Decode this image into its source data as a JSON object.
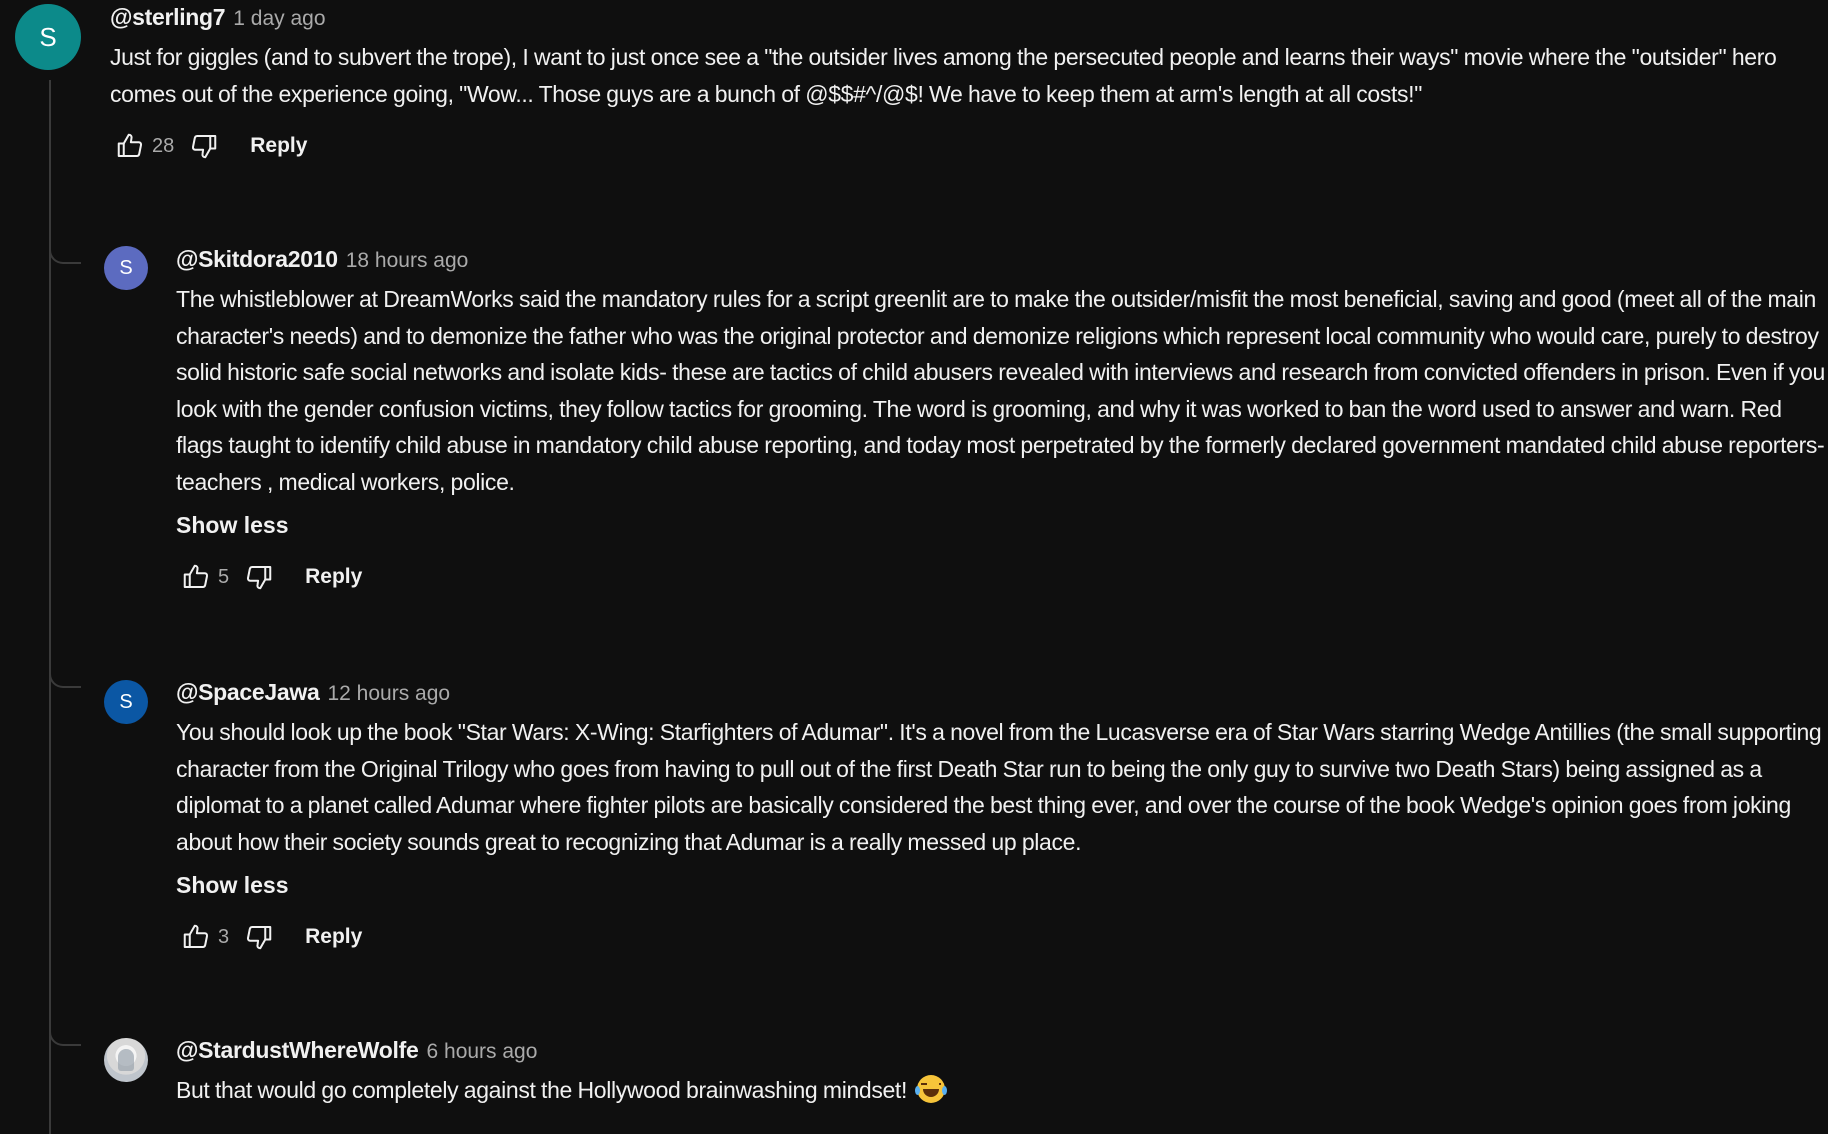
{
  "comments": [
    {
      "avatar_letter": "S",
      "avatar_color": "#0c8a8a",
      "author": "@sterling7",
      "time": "1 day ago",
      "text": "Just for giggles (and to subvert the trope), I want to just once see a \"the outsider lives among the persecuted people and learns their ways\" movie where the \"outsider\" hero comes out of the experience going, \"Wow... Those guys are a bunch of @$$#^/@$! We have to keep them at arm's length at all costs!\"",
      "likes": "28",
      "reply_label": "Reply"
    }
  ],
  "replies": [
    {
      "avatar_letter": "S",
      "avatar_color": "#5c6bc0",
      "author": "@Skitdora2010",
      "time": "18 hours ago",
      "text": "The whistleblower at DreamWorks said the mandatory rules for a script greenlit are to make the outsider/misfit the most beneficial, saving and good (meet all of the main character's needs) and to demonize the father who was the original protector and demonize religions which represent local community who would care, purely to destroy solid historic safe social networks and isolate kids- these are tactics of child abusers revealed with interviews and research from convicted offenders in prison. Even if you look with the gender confusion victims, they follow tactics for grooming. The word is grooming, and why it was worked to ban the word used to answer and warn. Red flags taught to identify child abuse in mandatory child abuse reporting, and today most perpetrated by the formerly declared government mandated child abuse reporters- teachers , medical workers, police.",
      "show_less": "Show less",
      "likes": "5",
      "reply_label": "Reply"
    },
    {
      "avatar_letter": "S",
      "avatar_color": "#0b57a4",
      "author": "@SpaceJawa",
      "time": "12 hours ago",
      "text": "You should look up the book \"Star Wars: X-Wing: Starfighters of Adumar\". It's a novel from the Lucasverse era of Star Wars starring Wedge Antillies (the small supporting character from the Original Trilogy who goes from having to pull out of the first Death Star run to being the only guy to survive two Death Stars) being assigned as a diplomat to a planet called Adumar where fighter pilots are basically considered the best thing ever, and over the course of the book Wedge's opinion goes from joking about how their society sounds great to recognizing that Adumar is a really messed up place.",
      "show_less": "Show less",
      "likes": "3",
      "reply_label": "Reply"
    },
    {
      "avatar_image": "profile-photo",
      "author": "@StardustWhereWolfe",
      "time": "6 hours ago",
      "text": "But that would go completely against the Hollywood brainwashing mindset!",
      "emoji": "laughing-with-tears-emoji"
    }
  ],
  "icons": {
    "like": "thumbs-up-icon",
    "dislike": "thumbs-down-icon"
  }
}
